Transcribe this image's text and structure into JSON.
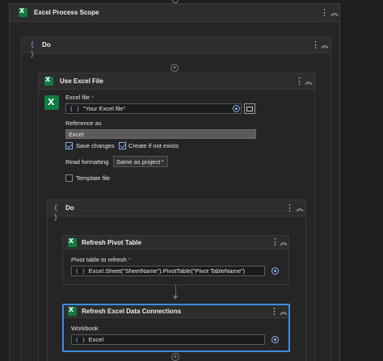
{
  "scope": {
    "title": "Excel Process Scope"
  },
  "outer_do": {
    "title": "Do"
  },
  "use_excel_file": {
    "title": "Use Excel File",
    "excel_file_label": "Excel file",
    "excel_file_value": "\"Your Excel file\"",
    "reference_as_label": "Reference as",
    "reference_as_value": "Excel",
    "save_changes_label": "Save changes",
    "save_changes_checked": true,
    "create_if_not_exists_label": "Create if not exists",
    "create_if_not_exists_checked": true,
    "read_formatting_label": "Read formatting",
    "read_formatting_value": "Same as project",
    "template_file_label": "Template file",
    "template_file_checked": false
  },
  "inner_do": {
    "title": "Do"
  },
  "refresh_pivot": {
    "title": "Refresh Pivot Table",
    "field_label": "Pivot table to refresh",
    "field_value": "Excel.Sheet(\"SheetName\").PivotTable(\"Pivot TableName\")"
  },
  "refresh_connections": {
    "title": "Refresh Excel Data Connections",
    "workbook_label": "Workbook",
    "workbook_value": "Excel"
  },
  "required_mark": "*",
  "icons": {
    "brace": "{ }",
    "plus": "+",
    "kebab": "⋮",
    "collapse": "︽"
  },
  "colors": {
    "accent": "#8ab4f8",
    "selected_border": "#3c8dde",
    "excel_green": "#107c41"
  }
}
